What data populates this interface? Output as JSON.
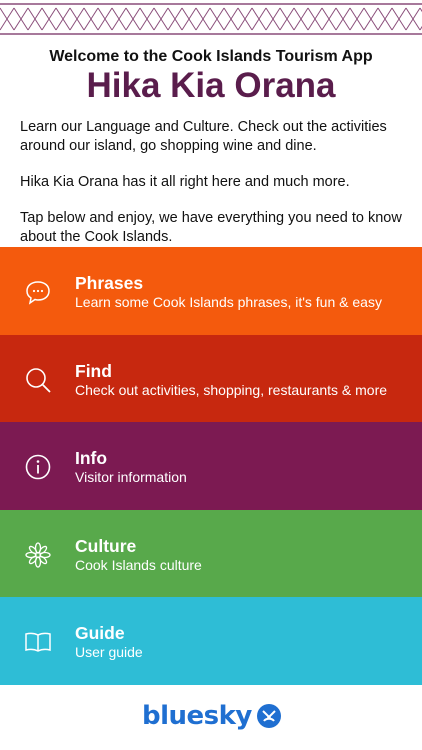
{
  "header": {
    "welcome": "Welcome to the Cook Islands Tourism App",
    "title": "Hika Kia Orana"
  },
  "intro": {
    "p1": "Learn our Language and Culture. Check out the activities around our island, go shopping wine and dine.",
    "p2": "Hika Kia Orana has it all right here and much more.",
    "p3": "Tap below and enjoy, we have everything you need to know about the Cook Islands."
  },
  "menu": [
    {
      "label": "Phrases",
      "sub": "Learn some Cook Islands phrases, it's fun & easy",
      "color": "#f45a0d",
      "icon": "speech-bubble-icon"
    },
    {
      "label": "Find",
      "sub": "Check out activities, shopping, restaurants & more",
      "color": "#c7280f",
      "icon": "search-icon"
    },
    {
      "label": "Info",
      "sub": "Visitor information",
      "color": "#7c1a52",
      "icon": "info-icon"
    },
    {
      "label": "Culture",
      "sub": "Cook Islands culture",
      "color": "#58a94b",
      "icon": "flower-icon"
    },
    {
      "label": "Guide",
      "sub": "User guide",
      "color": "#2ebdd6",
      "icon": "book-icon"
    }
  ],
  "footer": {
    "brand": "bluesky",
    "brand_color": "#1f6fd1"
  },
  "colors": {
    "title": "#5a1d4c",
    "pattern": "#7a2a63"
  }
}
